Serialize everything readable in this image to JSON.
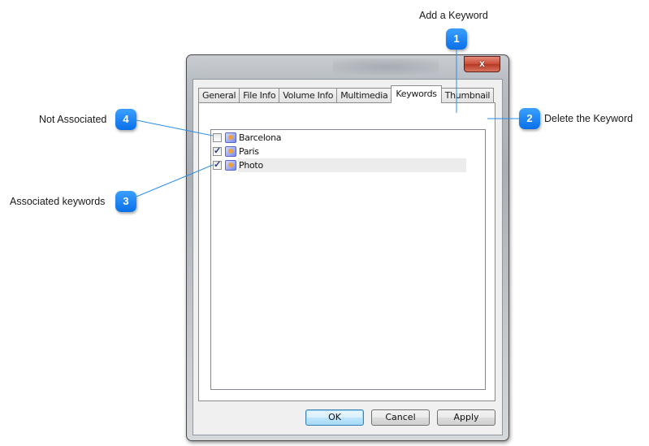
{
  "callouts": [
    {
      "number": "1",
      "label": "Add a Keyword"
    },
    {
      "number": "2",
      "label": "Delete the Keyword"
    },
    {
      "number": "3",
      "label": "Associated keywords"
    },
    {
      "number": "4",
      "label": "Not Associated"
    }
  ],
  "window": {
    "close_glyph": "x"
  },
  "tabs": [
    {
      "label": "General",
      "active": false
    },
    {
      "label": "File Info",
      "active": false
    },
    {
      "label": "Volume Info",
      "active": false
    },
    {
      "label": "Multimedia",
      "active": false
    },
    {
      "label": "Keywords",
      "active": true
    },
    {
      "label": "Thumbnail",
      "active": false
    }
  ],
  "keywords_panel": {
    "header": "Keywords",
    "add_icon": "folder-icon",
    "delete_icon": "delete-x-icon",
    "delete_glyph": "✕",
    "check_glyph": "✓",
    "items": [
      {
        "label": "Barcelona",
        "checked": false,
        "selected": false
      },
      {
        "label": "Paris",
        "checked": true,
        "selected": false
      },
      {
        "label": "Photo",
        "checked": true,
        "selected": true
      }
    ]
  },
  "buttons": {
    "ok": "OK",
    "cancel": "Cancel",
    "apply": "Apply"
  },
  "colors": {
    "callout_blue": "#0a6fe8",
    "leader_line": "#2b8ee8",
    "close_red": "#c94a35",
    "default_button": "#bee6fd"
  }
}
